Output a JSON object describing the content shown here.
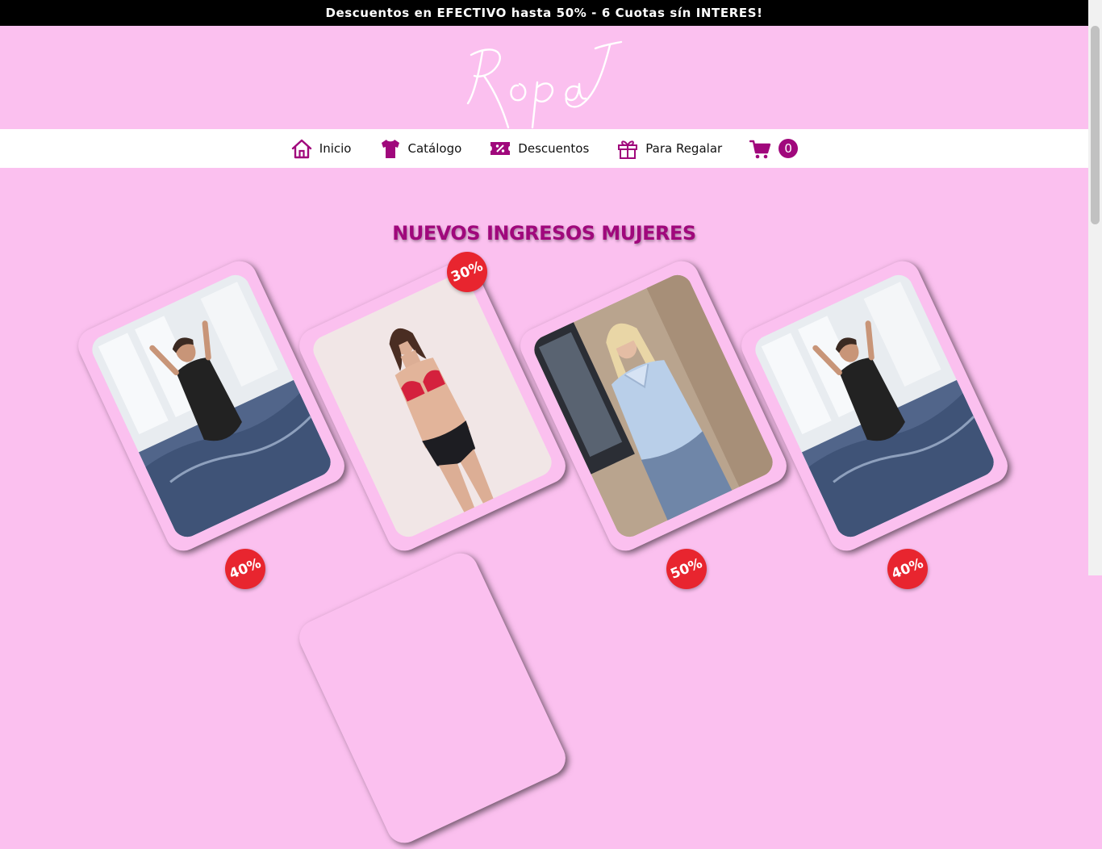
{
  "promo": {
    "text": "Descuentos en EFECTIVO hasta 50% - 6 Cuotas sín INTERES!"
  },
  "logo": {
    "text": "RopaJ"
  },
  "nav": {
    "items": [
      {
        "label": "Inicio",
        "icon": "home-icon"
      },
      {
        "label": "Catálogo",
        "icon": "tshirt-icon"
      },
      {
        "label": "Descuentos",
        "icon": "percent-ticket-icon"
      },
      {
        "label": "Para Regalar",
        "icon": "gift-icon"
      }
    ],
    "cart_count": "0"
  },
  "section": {
    "title": "NUEVOS INGRESOS MUJERES"
  },
  "products": [
    {
      "image": "woman in black swimsuit in pool",
      "badge": ""
    },
    {
      "image": "woman in red bikini top",
      "badge": "30%"
    },
    {
      "image": "woman in light blue blouse",
      "badge": ""
    },
    {
      "image": "woman in black swimsuit in pool",
      "badge": ""
    }
  ],
  "next_row_badges": [
    "40%",
    "50%",
    "40%"
  ],
  "colors": {
    "brand": "#a0087c",
    "background": "#fbc0ef",
    "badge": "#e8252f"
  }
}
